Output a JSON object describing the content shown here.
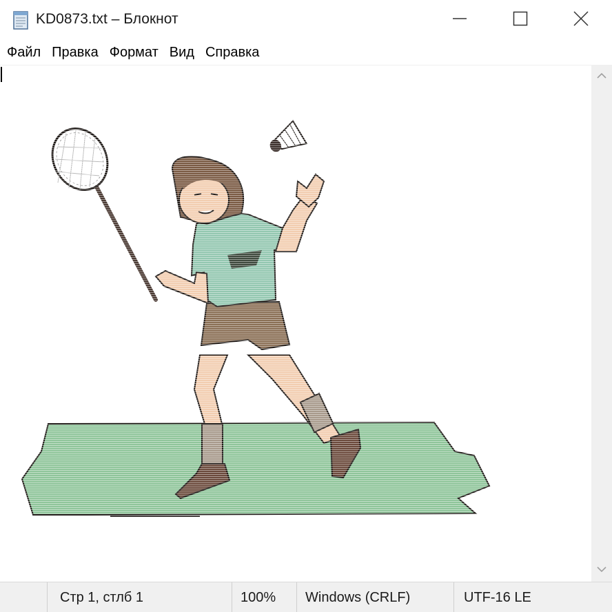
{
  "window": {
    "title": "KD0873.txt – Блокнот",
    "app_icon": "notepad-icon",
    "controls": {
      "minimize_icon": "minimize-icon",
      "maximize_icon": "maximize-icon",
      "close_icon": "close-icon"
    }
  },
  "menu": {
    "items": [
      "Файл",
      "Правка",
      "Формат",
      "Вид",
      "Справка"
    ]
  },
  "editor": {
    "content_icon": "badminton-player-ascii-art",
    "colors": {
      "court": "#8fc59a",
      "shirt": "#93c7b0",
      "shorts": "#8a6f55",
      "hair": "#7a5a43",
      "skin": "#f2cdb0",
      "outline": "#1f1a17"
    }
  },
  "scrollbar": {
    "up_icon": "chevron-up-icon",
    "down_icon": "chevron-down-icon"
  },
  "status": {
    "position": "Стр 1, стлб 1",
    "zoom": "100%",
    "line_endings": "Windows (CRLF)",
    "encoding": "UTF-16 LE"
  }
}
